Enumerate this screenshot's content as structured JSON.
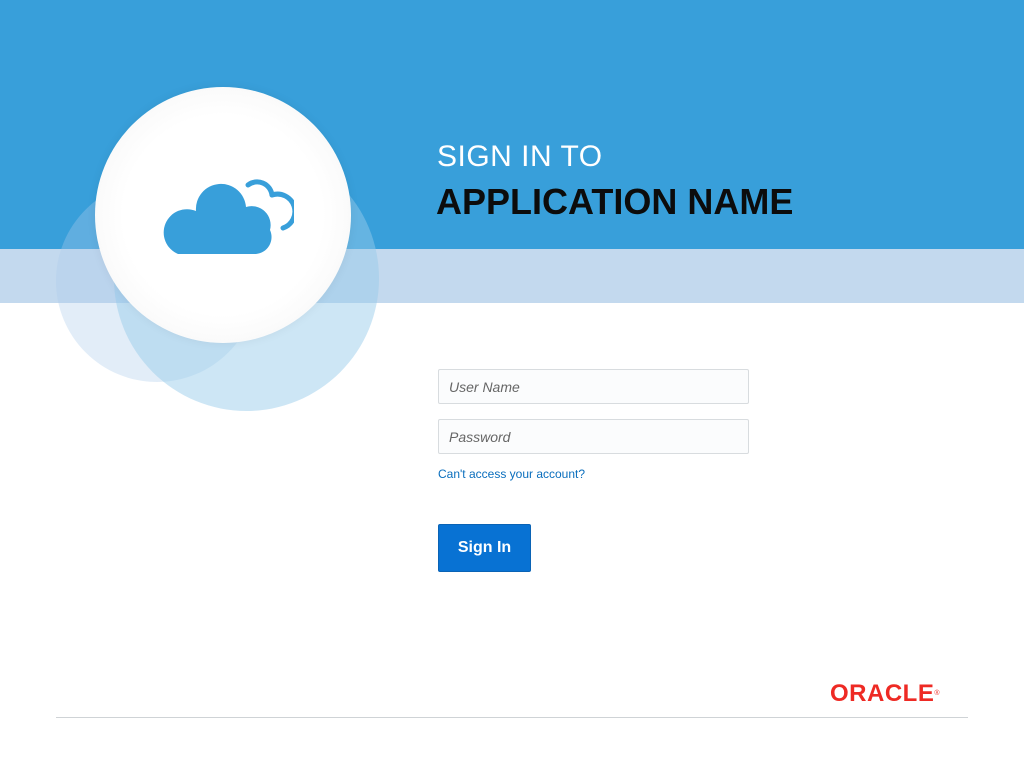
{
  "header": {
    "title_prefix": "SIGN IN TO",
    "title_main": "APPLICATION NAME"
  },
  "icons": {
    "hero": "cloud-icon"
  },
  "form": {
    "username_placeholder": "User Name",
    "username_value": "",
    "password_placeholder": "Password",
    "password_value": "",
    "help_link": "Can't access your account?",
    "signin_label": "Sign In"
  },
  "footer": {
    "brand": "ORACLE",
    "registered_mark": "®"
  },
  "colors": {
    "header_band": "#389fda",
    "light_band": "#c3d9ee",
    "primary_button": "#0872d3",
    "link": "#0a6ebd",
    "brand": "#ee2a24"
  }
}
